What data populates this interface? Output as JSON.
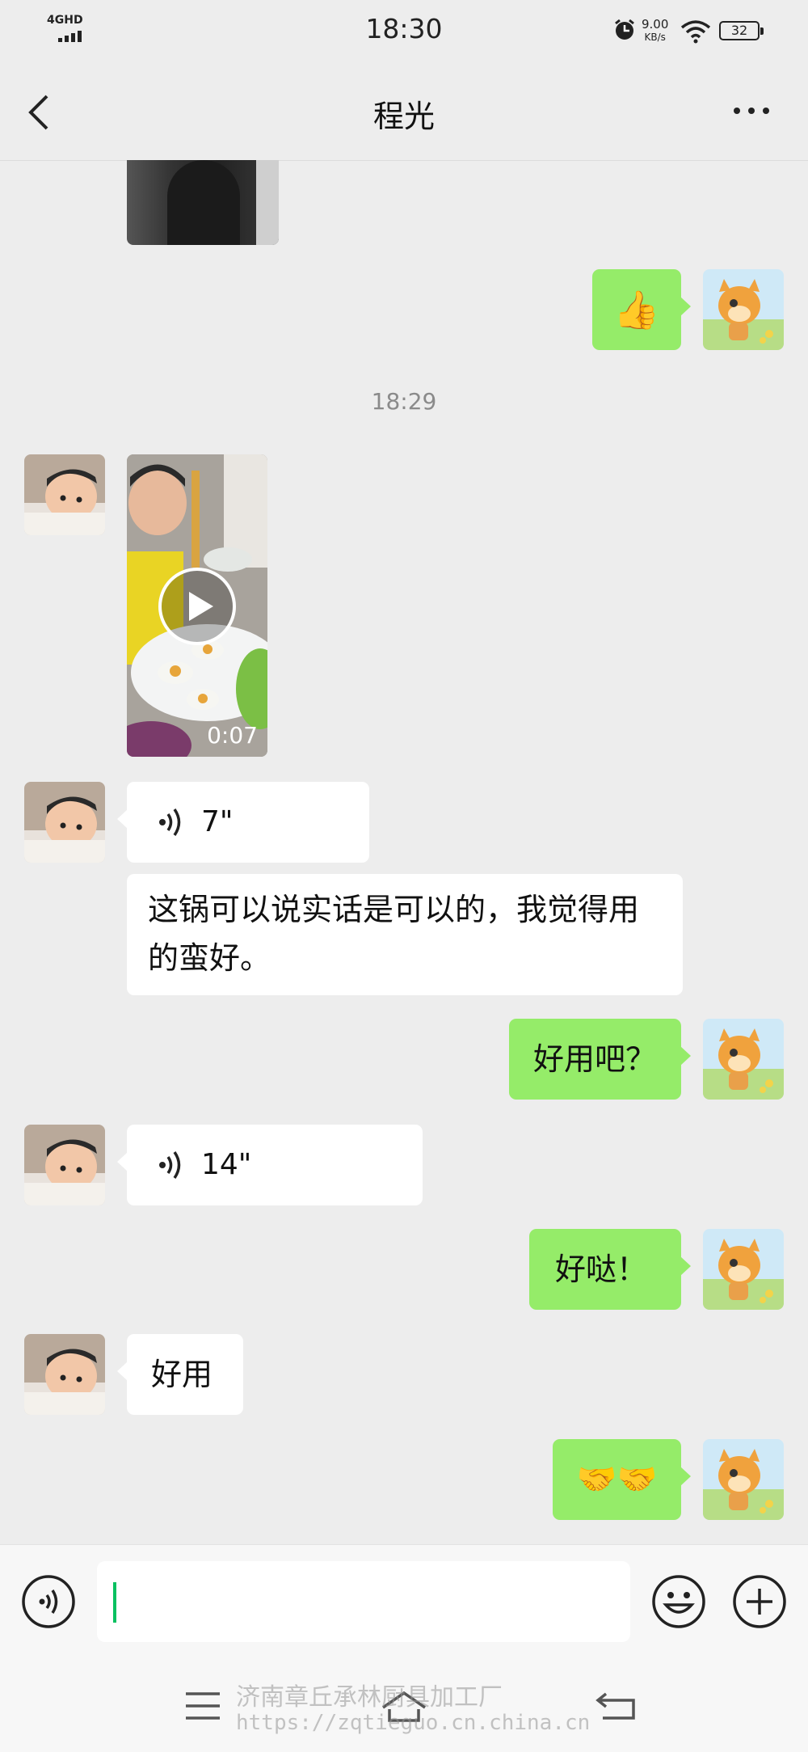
{
  "status_bar": {
    "network": "4GHD",
    "time": "18:30",
    "speed_value": "9.00",
    "speed_unit": "KB/s",
    "battery": "32"
  },
  "header": {
    "title": "程光"
  },
  "messages": {
    "timestamp": "18:29",
    "video_duration": "0:07",
    "voice_1": "7\"",
    "text_1": "这锅可以说实话是可以的，我觉得用的蛮好。",
    "reply_1": "好用吧？",
    "voice_2": "14\"",
    "reply_2": "好哒！",
    "text_2": "好用",
    "emoji_thumbs": "👍",
    "emoji_handshake": "🤝🤝"
  },
  "input": {
    "placeholder": ""
  },
  "watermark": {
    "line1": "济南章丘承林厨具加工厂",
    "line2": "https://zqtieguo.cn.china.cn"
  },
  "colors": {
    "sent_bubble": "#95ec69",
    "received_bubble": "#ffffff",
    "background": "#ededed",
    "cursor": "#07c160"
  }
}
